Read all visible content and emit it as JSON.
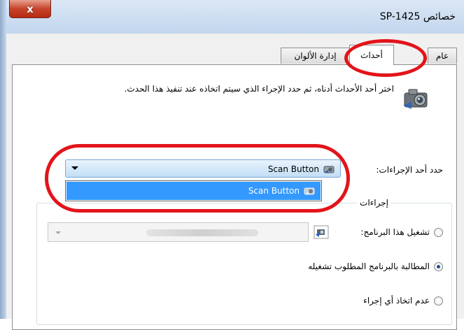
{
  "window": {
    "title": "خصائص SP-1425",
    "close_glyph": "x"
  },
  "tabs": [
    {
      "label": "عام",
      "active": false
    },
    {
      "label": "أحداث",
      "active": true
    },
    {
      "label": "إدارة الألوان",
      "active": false
    }
  ],
  "events": {
    "description": "اختر أحد الأحداث أدناه، ثم حدد الإجراء الذي سيتم اتخاذه عند تنفيذ هذا الحدث.",
    "select_label": "حدد أحد الإجراءات:",
    "selected_event": "Scan Button",
    "dropdown_options": [
      "Scan Button"
    ]
  },
  "actions": {
    "group_title": "إجراءات",
    "options": [
      {
        "label": "تشغيل هذا البرنامج:",
        "checked": false
      },
      {
        "label": "المطالبة بالبرنامج المطلوب تشغيله",
        "checked": true
      },
      {
        "label": "عدم اتخاذ أي إجراء",
        "checked": false
      }
    ]
  },
  "colors": {
    "highlight": "#e2141a",
    "selection": "#3399ff"
  }
}
